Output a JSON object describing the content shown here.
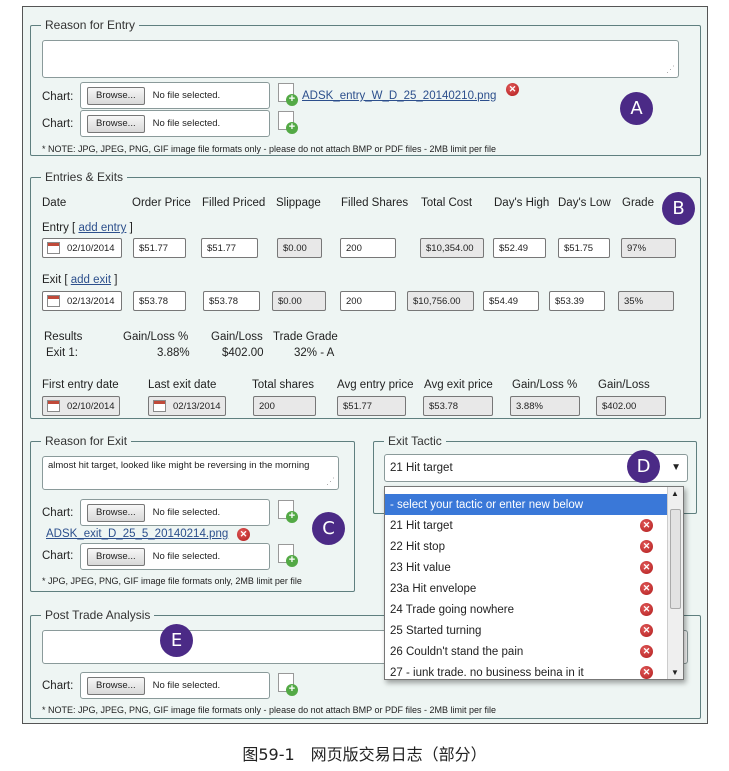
{
  "reason_entry": {
    "legend": "Reason for Entry",
    "chart_label": "Chart:",
    "browse_label": "Browse...",
    "no_file": "No file selected.",
    "attached_file": "ADSK_entry_W_D_25_20140210.png",
    "note": "* NOTE: JPG, JPEG, PNG, GIF image file formats only - please do not attach BMP or PDF files - 2MB limit per file"
  },
  "entries_exits": {
    "legend": "Entries & Exits",
    "headers": [
      "Date",
      "Order Price",
      "Filled Priced",
      "Slippage",
      "Filled Shares",
      "Total Cost",
      "Day's High",
      "Day's Low",
      "Grade"
    ],
    "entry_label": "Entry [",
    "entry_link": "add entry",
    "entry_close": "]",
    "entry_row": {
      "date": "02/10/2014",
      "order_price": "$51.77",
      "filled_price": "$51.77",
      "slippage": "$0.00",
      "filled_shares": "200",
      "total_cost": "$10,354.00",
      "days_high": "$52.49",
      "days_low": "$51.75",
      "grade": "97%"
    },
    "exit_label": "Exit [",
    "exit_link": "add exit",
    "exit_close": "]",
    "exit_row": {
      "date": "02/13/2014",
      "order_price": "$53.78",
      "filled_price": "$53.78",
      "slippage": "$0.00",
      "filled_shares": "200",
      "total_cost": "$10,756.00",
      "days_high": "$54.49",
      "days_low": "$53.39",
      "grade": "35%"
    },
    "results": {
      "label": "Results",
      "gl_pct_label": "Gain/Loss %",
      "gl_label": "Gain/Loss",
      "grade_label": "Trade Grade",
      "exit_name": "Exit 1:",
      "gl_pct": "3.88%",
      "gl": "$402.00",
      "grade": "32% - A"
    },
    "summary_headers": [
      "First entry date",
      "Last exit date",
      "Total shares",
      "Avg entry price",
      "Avg exit price",
      "Gain/Loss %",
      "Gain/Loss"
    ],
    "summary_values": [
      "02/10/2014",
      "02/13/2014",
      "200",
      "$51.77",
      "$53.78",
      "3.88%",
      "$402.00"
    ]
  },
  "reason_exit": {
    "legend": "Reason for Exit",
    "text": "almost hit target, looked like might be reversing in the morning",
    "chart_label": "Chart:",
    "browse_label": "Browse...",
    "no_file": "No file selected.",
    "attached_file": "ADSK_exit_D_25_5_20140214.png",
    "note": "* JPG, JPEG, PNG, GIF image file formats only, 2MB limit per file"
  },
  "exit_tactic": {
    "legend": "Exit Tactic",
    "selected": "21 Hit target",
    "options": [
      "- select your tactic or enter new below",
      "21 Hit target",
      "22 Hit stop",
      "23 Hit value",
      "23a Hit envelope",
      "24 Trade going nowhere",
      "25 Started turning",
      "26 Couldn't stand the pain",
      "27 - iunk trade. no business beina in it"
    ]
  },
  "post_trade": {
    "legend": "Post Trade Analysis",
    "chart_label": "Chart:",
    "browse_label": "Browse...",
    "no_file": "No file selected.",
    "note": "* NOTE: JPG, JPEG, PNG, GIF image file formats only - please do not attach BMP or PDF files - 2MB limit per file"
  },
  "badges": {
    "a": "A",
    "b": "B",
    "c": "C",
    "d": "D",
    "e": "E"
  },
  "caption": "图59-1　网页版交易日志（部分）",
  "colors": {
    "badge": "#4b2a86",
    "selection": "#3a78d8",
    "link": "#2c4f8c",
    "panel": "#eef5f3"
  }
}
